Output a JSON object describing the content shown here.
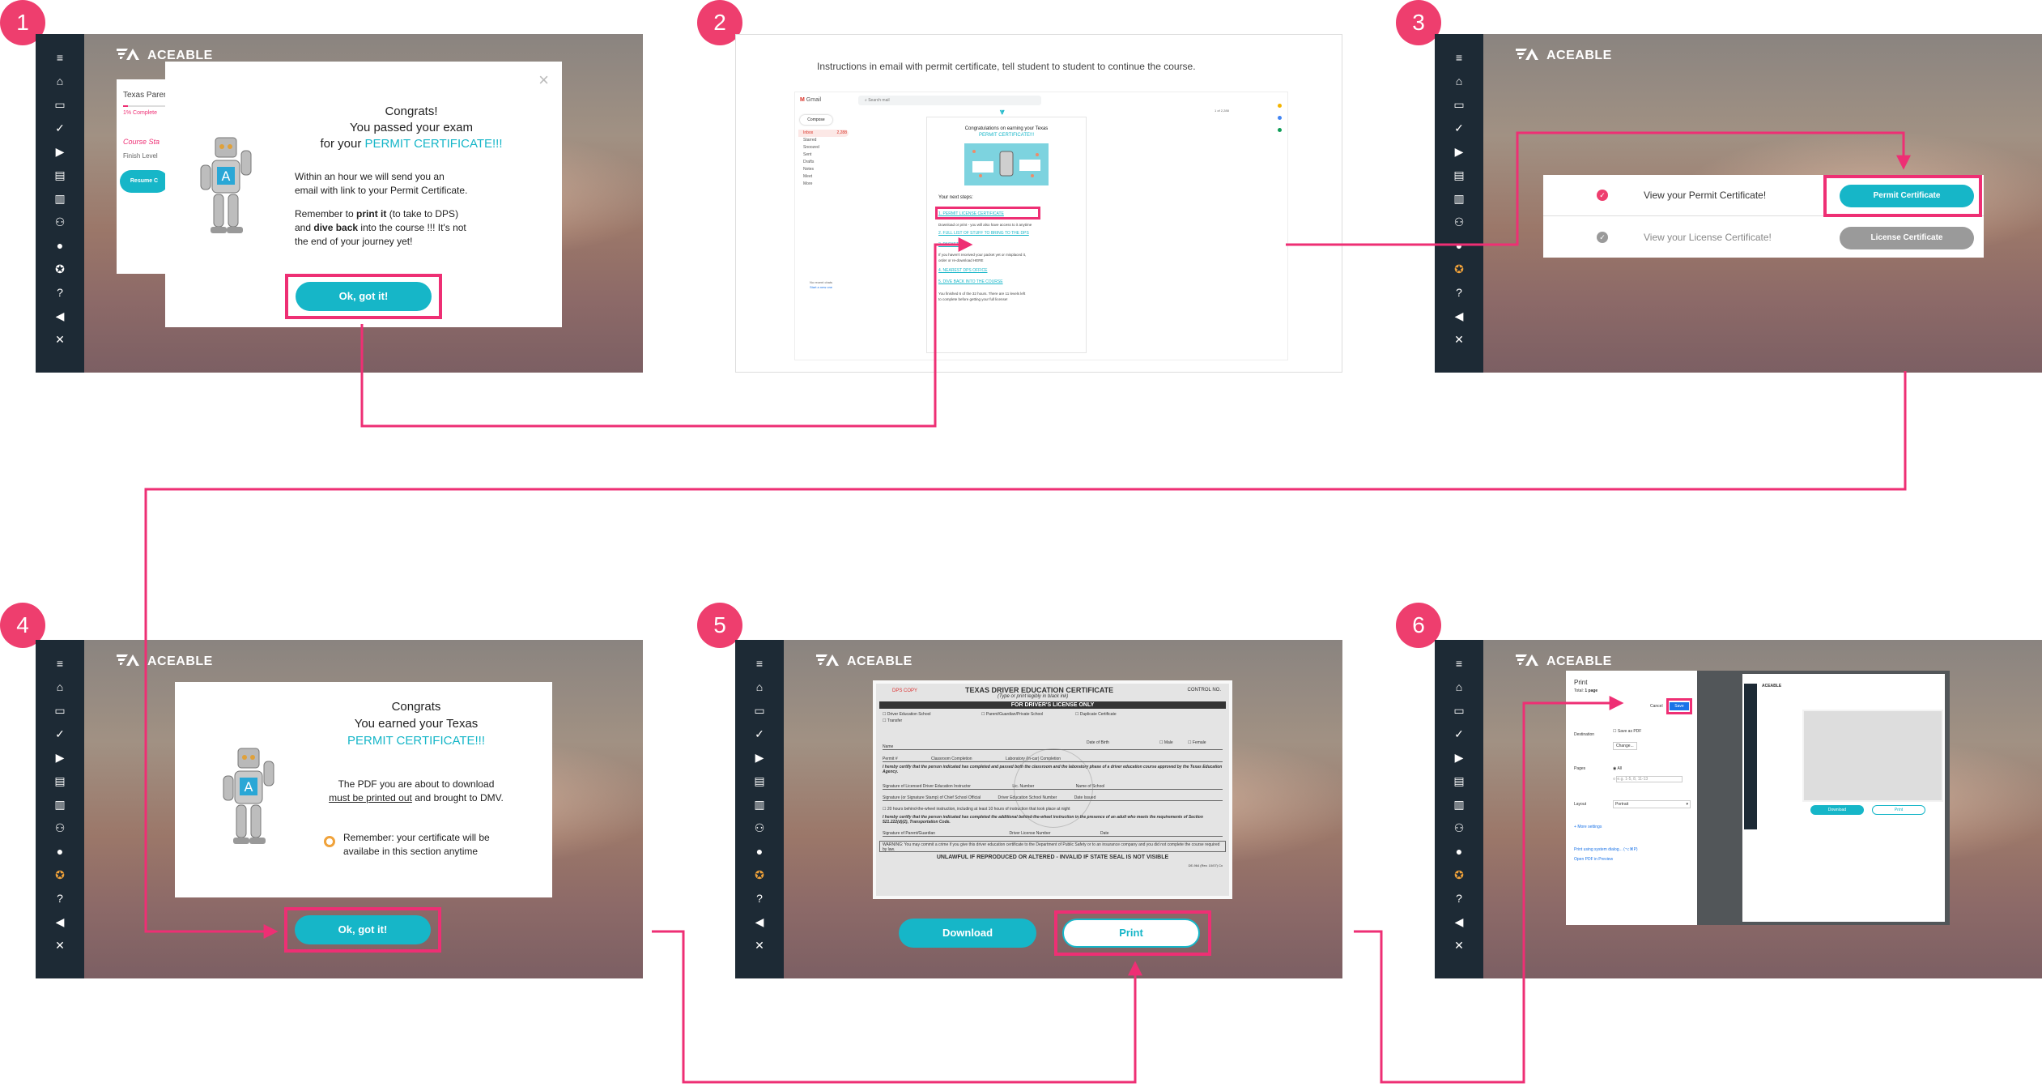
{
  "steps": [
    "1",
    "2",
    "3",
    "4",
    "5",
    "6"
  ],
  "brand": "ACEABLE",
  "sidebar_icons": [
    "menu-icon",
    "home-icon",
    "card-icon",
    "check-icon",
    "play-icon",
    "book-icon",
    "stats-icon",
    "user-group-icon",
    "user-icon",
    "badge-icon",
    "help-icon",
    "volume-icon",
    "close-icon"
  ],
  "colors": {
    "accent": "#16b6c8",
    "highlight": "#ee2f74",
    "sidebar": "#1d2a35",
    "badge": "#ee3e6e"
  },
  "panel1": {
    "course_title": "Texas Paren",
    "progress": "1% Complete",
    "course_status": "Course Sta",
    "finish_level": "Finish Level",
    "resume": "Resume C",
    "heading1": "Congrats!",
    "heading2": "You passed your exam",
    "heading3_pre": "for your ",
    "heading3_accent": "PERMIT CERTIFICATE!!!",
    "body1": "Within an hour we will send you an",
    "body2": "email with link to your Permit Certificate.",
    "body3_pre": "Remember to ",
    "body3_bold": "print it",
    "body3_post": " (to take to DPS)",
    "body4_pre": "and ",
    "body4_bold": "dive back",
    "body4_post": " into the course !!! It's not",
    "body5": "the end of your journey yet!",
    "button": "Ok, got it!"
  },
  "panel2": {
    "instructions": "Instructions in email with permit certificate, tell student to student to continue the course.",
    "gmail_label": "Gmail",
    "search_placeholder": "Search mail",
    "compose": "Compose",
    "nav": [
      "Inbox",
      "Starred",
      "Snoozed",
      "Sent",
      "Drafts",
      "Notes",
      "Meet",
      "More"
    ],
    "inbox_count": "2,288",
    "email_heading": "Congratulations on earning your Texas",
    "email_heading_accent": "PERMIT CERTIFICATE!!!",
    "next_steps": "Your next steps:",
    "step1": "1. PERMIT LICENSE CERTIFICATE",
    "step1_note": "Download or print - you will also have access to it anytime",
    "step2": "2. FULL LIST OF STUFF TO BRING TO THE DPS",
    "step3": "3. PACKET",
    "step3_note1": "If you haven't received your packet yet or misplaced it,",
    "step3_note2": "order or re-download HERE",
    "step4": "4. NEAREST DPS OFFICE",
    "step5": "5. DIVE BACK INTO THE COURSE",
    "finish_note1": "You finished 6 of the 32 hours. There are 11 levels left",
    "finish_note2": "to complete before getting your full license!",
    "no_recent": "No recent chats",
    "start_new": "Start a new one",
    "paging": "1 of 2,288"
  },
  "panel3": {
    "row1_label": "View your Permit Certificate!",
    "row1_button": "Permit Certificate",
    "row2_label": "View your License Certificate!",
    "row2_button": "License Certificate"
  },
  "panel4": {
    "heading1": "Congrats",
    "heading2": "You earned your Texas",
    "heading3": "PERMIT CERTIFICATE!!!",
    "body1": "The PDF you are about to download",
    "body2_u": "must be printed out",
    "body2_post": " and brought to DMV.",
    "remember1": "Remember: your certificate will be",
    "remember2": "availabe in this section anytime",
    "button": "Ok, got it!"
  },
  "panel5": {
    "dps_copy": "DPS COPY",
    "cert_title": "TEXAS DRIVER EDUCATION CERTIFICATE",
    "cert_sub": "(Type or print legibly in black ink)",
    "control_no": "CONTROL NO.",
    "bar": "FOR DRIVER'S LICENSE ONLY",
    "check1": "Driver Education School",
    "check2": "Parent/Guardian/Private School",
    "check3": "Duplicate Certificate",
    "transfer": "Transfer",
    "line_name": "Name",
    "line_dob": "Date of Birth",
    "male": "Male",
    "female": "Female",
    "permit": "Permit #",
    "classroom": "Classroom Completion",
    "lab": "Laboratory (In-car) Completion",
    "certify1": "I hereby certify that the person indicated has completed and passed both the classroom and the laboratory phase of a driver education course approved by the Texas Education Agency.",
    "sig1": "Signature of Licensed Driver Education Instructor",
    "lic_no": "Lic. Number",
    "school": "Name of School",
    "sig2": "Signature (or Signature Stamp) of Chief School Official",
    "school_no": "Driver Education School Number",
    "date_issued": "Date Issued",
    "hours": "20 hours behind-the-wheel instruction, including at least 10 hours of instruction that took place at night",
    "certify2": "I hereby certify that the person indicated has completed the additional behind-the-wheel instruction in the presence of an adult who meets the requirements of Section 521.222(d)(2), Transportation Code.",
    "sig3": "Signature of Parent/Guardian",
    "dl_no": "Driver License Number",
    "date": "Date",
    "warning": "WARNING: You may commit a crime if you give this driver education certificate to the Department of Public Safety or to an insurance company and you did not complete the course required by law.",
    "footer": "UNLAWFUL IF REPRODUCED OR ALTERED - INVALID IF STATE SEAL IS NOT VISIBLE",
    "form_no": "DE-964 (Rev. 10/07) Cx",
    "download": "Download",
    "print": "Print"
  },
  "panel6": {
    "print_title": "Print",
    "total_label": "Total: ",
    "total_value": "1 page",
    "cancel": "Cancel",
    "save": "Save",
    "destination": "Destination",
    "save_as_pdf": "Save as PDF",
    "change": "Change...",
    "pages": "Pages",
    "all": "All",
    "range_placeholder": "e.g. 1-5, 8, 11-13",
    "layout": "Layout",
    "portrait": "Portrait",
    "more_settings": "More settings",
    "system_dialog": "Print using system dialog... (⌥⌘P)",
    "open_preview": "Open PDF in Preview",
    "preview_download": "Download",
    "preview_print": "Print"
  }
}
